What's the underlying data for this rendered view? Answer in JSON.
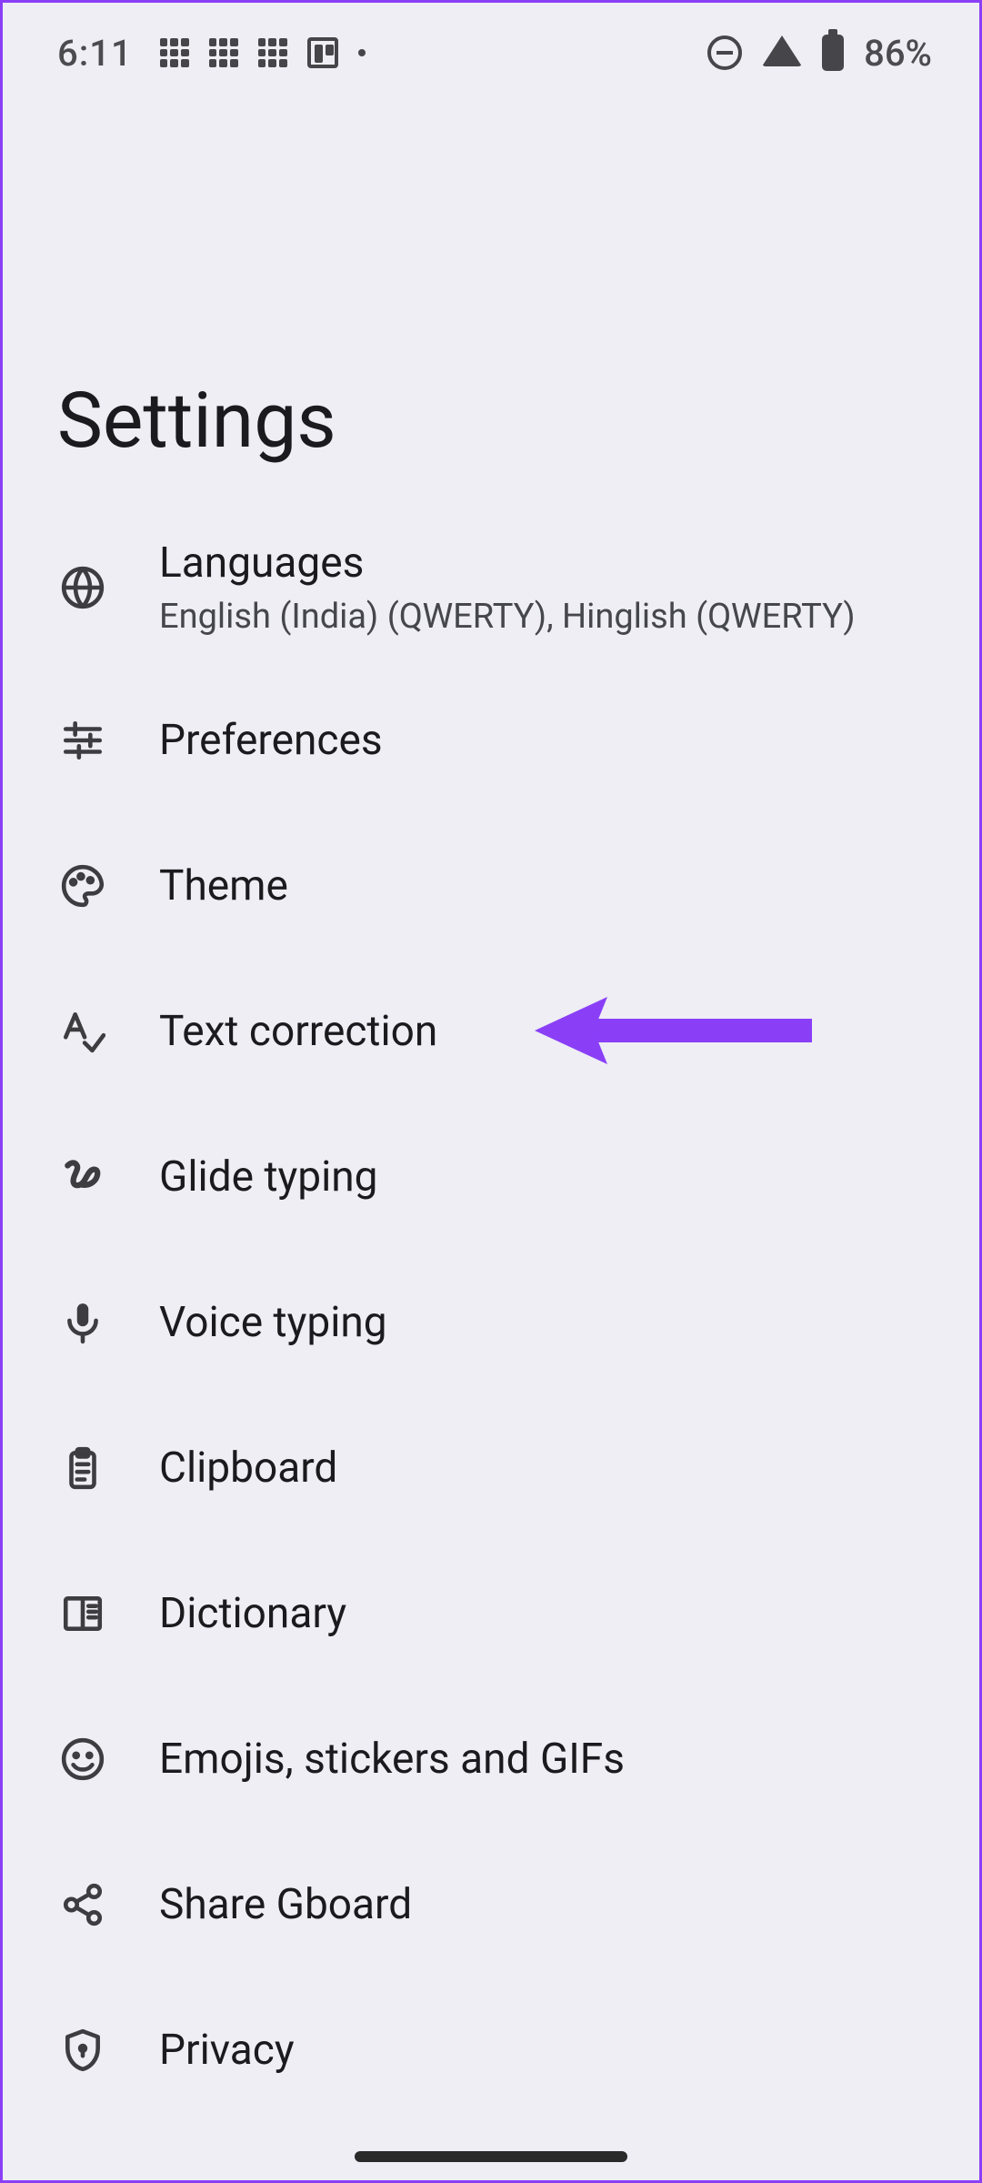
{
  "status": {
    "time": "6:11",
    "battery_text": "86%"
  },
  "title": "Settings",
  "items": {
    "languages": {
      "label": "Languages",
      "subtitle": "English (India) (QWERTY), Hinglish (QWERTY)"
    },
    "preferences": {
      "label": "Preferences"
    },
    "theme": {
      "label": "Theme"
    },
    "text_correction": {
      "label": "Text correction"
    },
    "glide_typing": {
      "label": "Glide typing"
    },
    "voice_typing": {
      "label": "Voice typing"
    },
    "clipboard": {
      "label": "Clipboard"
    },
    "dictionary": {
      "label": "Dictionary"
    },
    "emojis": {
      "label": "Emojis, stickers and GIFs"
    },
    "share": {
      "label": "Share Gboard"
    },
    "privacy": {
      "label": "Privacy"
    }
  },
  "annotation": {
    "arrow_color": "#8a3ff7"
  }
}
